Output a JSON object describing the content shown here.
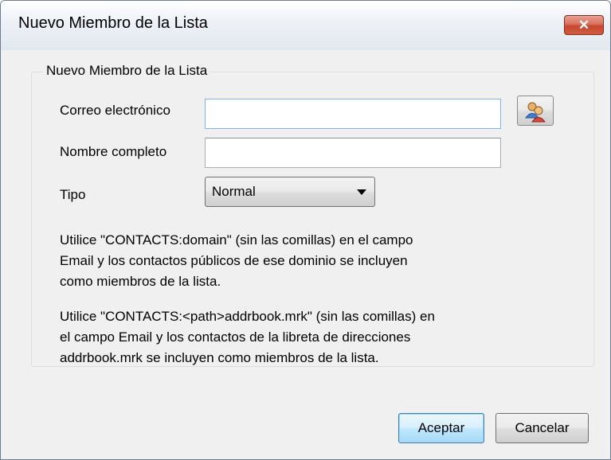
{
  "window": {
    "title": "Nuevo Miembro de la Lista",
    "close_icon": "close-icon",
    "close_glyph": "✕"
  },
  "group": {
    "legend": "Nuevo Miembro de la Lista"
  },
  "form": {
    "email_label": "Correo electrónico",
    "email_value": "",
    "address_book_icon": "address-book-icon",
    "fullname_label": "Nombre completo",
    "fullname_value": "",
    "type_label": "Tipo",
    "type_value": "Normal"
  },
  "help": {
    "para1_line1": "Utilice \"CONTACTS:domain\" (sin las comillas) en el campo",
    "para1_line2": "Email y los contactos públicos de ese dominio se incluyen",
    "para1_line3": "como miembros de la lista.",
    "para2_line1": "Utilice \"CONTACTS:<path>addrbook.mrk\" (sin las comillas) en",
    "para2_line2": "el campo Email y los contactos de la libreta de direcciones",
    "para2_line3": "addrbook.mrk se incluyen como miembros de la lista."
  },
  "buttons": {
    "ok": "Aceptar",
    "cancel": "Cancelar"
  }
}
